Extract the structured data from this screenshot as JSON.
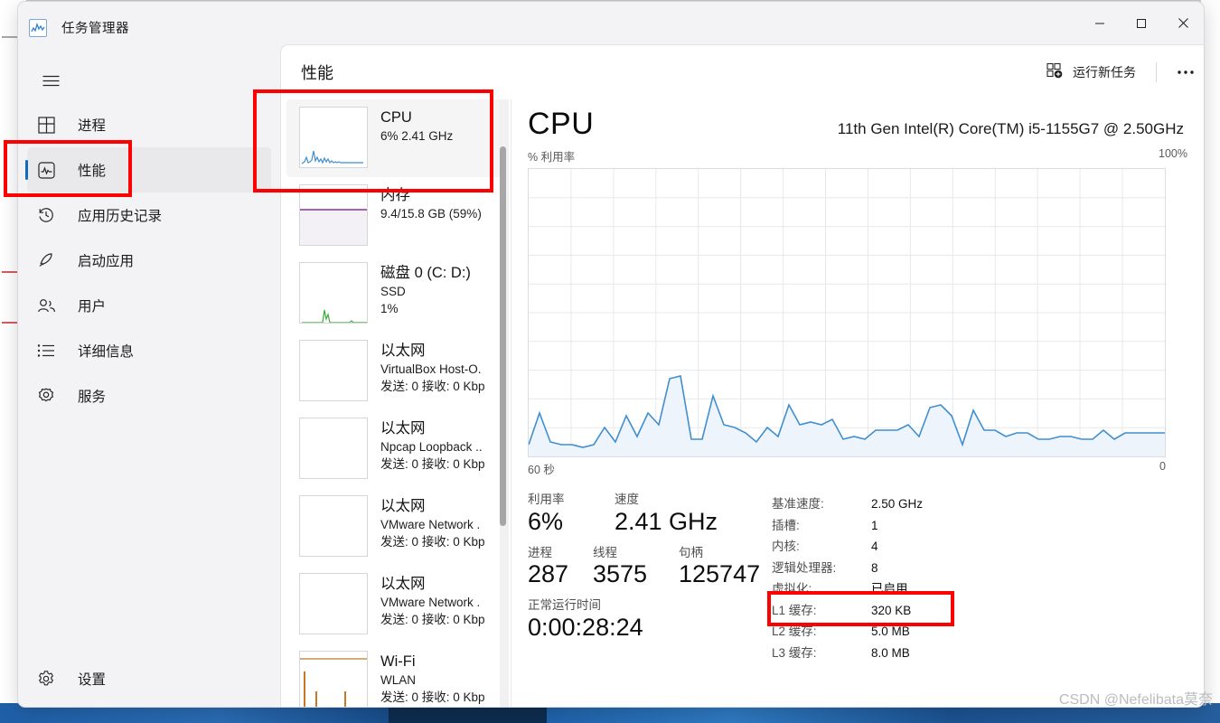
{
  "window": {
    "title": "任务管理器",
    "app_icon": "chart-icon",
    "controls": {
      "minimize": "minimize-icon",
      "maximize": "maximize-icon",
      "close": "close-icon"
    }
  },
  "sidebar": {
    "menu_icon": "hamburger-icon",
    "items": [
      {
        "label": "进程",
        "icon": "processes-icon",
        "selected": false
      },
      {
        "label": "性能",
        "icon": "performance-icon",
        "selected": true
      },
      {
        "label": "应用历史记录",
        "icon": "history-icon",
        "selected": false
      },
      {
        "label": "启动应用",
        "icon": "startup-icon",
        "selected": false
      },
      {
        "label": "用户",
        "icon": "users-icon",
        "selected": false
      },
      {
        "label": "详细信息",
        "icon": "details-icon",
        "selected": false
      },
      {
        "label": "服务",
        "icon": "services-icon",
        "selected": false
      }
    ],
    "settings": {
      "label": "设置",
      "icon": "gear-icon"
    }
  },
  "header": {
    "title": "性能",
    "run_new_task": "运行新任务",
    "run_new_task_icon": "new-task-icon",
    "more_label": "···",
    "more_icon": "more-icon"
  },
  "device_list": [
    {
      "name": "CPU",
      "sub1": "6% 2.41 GHz",
      "sub2": "",
      "selected": true,
      "color": "#3f8fd0",
      "spark": "cpu"
    },
    {
      "name": "内存",
      "sub1": "9.4/15.8 GB (59%)",
      "sub2": "",
      "selected": false,
      "color": "#8b2fa0",
      "spark": "memory"
    },
    {
      "name": "磁盘 0 (C: D:)",
      "sub1": "SSD",
      "sub2": "1%",
      "selected": false,
      "color": "#3caa3c",
      "spark": "disk"
    },
    {
      "name": "以太网",
      "sub1": "VirtualBox Host-O.",
      "sub2": "发送: 0 接收: 0 Kbp",
      "selected": false,
      "color": "#b97a2a",
      "spark": "flat"
    },
    {
      "name": "以太网",
      "sub1": "Npcap Loopback ..",
      "sub2": "发送: 0 接收: 0 Kbp",
      "selected": false,
      "color": "#b97a2a",
      "spark": "flat"
    },
    {
      "name": "以太网",
      "sub1": "VMware Network .",
      "sub2": "发送: 0 接收: 0 Kbp",
      "selected": false,
      "color": "#b97a2a",
      "spark": "flat"
    },
    {
      "name": "以太网",
      "sub1": "VMware Network .",
      "sub2": "发送: 0 接收: 0 Kbp",
      "selected": false,
      "color": "#b97a2a",
      "spark": "flat"
    },
    {
      "name": "Wi-Fi",
      "sub1": "WLAN",
      "sub2": "发送: 0 接收: 0 Kbp",
      "selected": false,
      "color": "#b97a2a",
      "spark": "wifi"
    }
  ],
  "detail": {
    "title": "CPU",
    "model": "11th Gen Intel(R) Core(TM) i5-1155G7 @ 2.50GHz",
    "y_axis_label": "% 利用率",
    "y_axis_max": "100%",
    "x_axis_left": "60 秒",
    "x_axis_right": "0",
    "stats": [
      {
        "label": "利用率",
        "value": "6%"
      },
      {
        "label": "速度",
        "value": "2.41 GHz"
      },
      {
        "label": "进程",
        "value": "287"
      },
      {
        "label": "线程",
        "value": "3575"
      },
      {
        "label": "句柄",
        "value": "125747"
      },
      {
        "label": "正常运行时间",
        "value": "0:00:28:24"
      }
    ],
    "specs": [
      {
        "key": "基准速度:",
        "value": "2.50 GHz"
      },
      {
        "key": "插槽:",
        "value": "1"
      },
      {
        "key": "内核:",
        "value": "4"
      },
      {
        "key": "逻辑处理器:",
        "value": "8"
      },
      {
        "key": "虚拟化:",
        "value": "已启用"
      },
      {
        "key": "L1 缓存:",
        "value": "320 KB"
      },
      {
        "key": "L2 缓存:",
        "value": "5.0 MB"
      },
      {
        "key": "L3 缓存:",
        "value": "8.0 MB"
      }
    ]
  },
  "chart_data": {
    "type": "area",
    "title": "CPU 利用率",
    "xlabel": "60 秒",
    "ylabel": "% 利用率",
    "ylim": [
      0,
      100
    ],
    "xlim": [
      60,
      0
    ],
    "grid": true,
    "grid_cols": 15,
    "grid_rows": 10,
    "line_color": "#3f8fd0",
    "fill_color": "#eef4fb",
    "series": [
      {
        "name": "CPU 利用率",
        "values": [
          4,
          15,
          5,
          4,
          4,
          3,
          4,
          10,
          5,
          14,
          7,
          15,
          11,
          27,
          28,
          6,
          6,
          21,
          11,
          10,
          8,
          5,
          10,
          7,
          18,
          10,
          11,
          10,
          13,
          6,
          7,
          6,
          9,
          9,
          9,
          11,
          6,
          17,
          19,
          14,
          4,
          16,
          9,
          9,
          7,
          8,
          8,
          6,
          6,
          7,
          7,
          6,
          6,
          9,
          6,
          8,
          8
        ]
      }
    ]
  },
  "annotations": {
    "boxes": [
      "性能-sidebar-highlight",
      "CPU-card-highlight",
      "虚拟化-row-highlight"
    ],
    "color": "#ff0000"
  },
  "watermark": "CSDN @Nefelibata莫奈"
}
